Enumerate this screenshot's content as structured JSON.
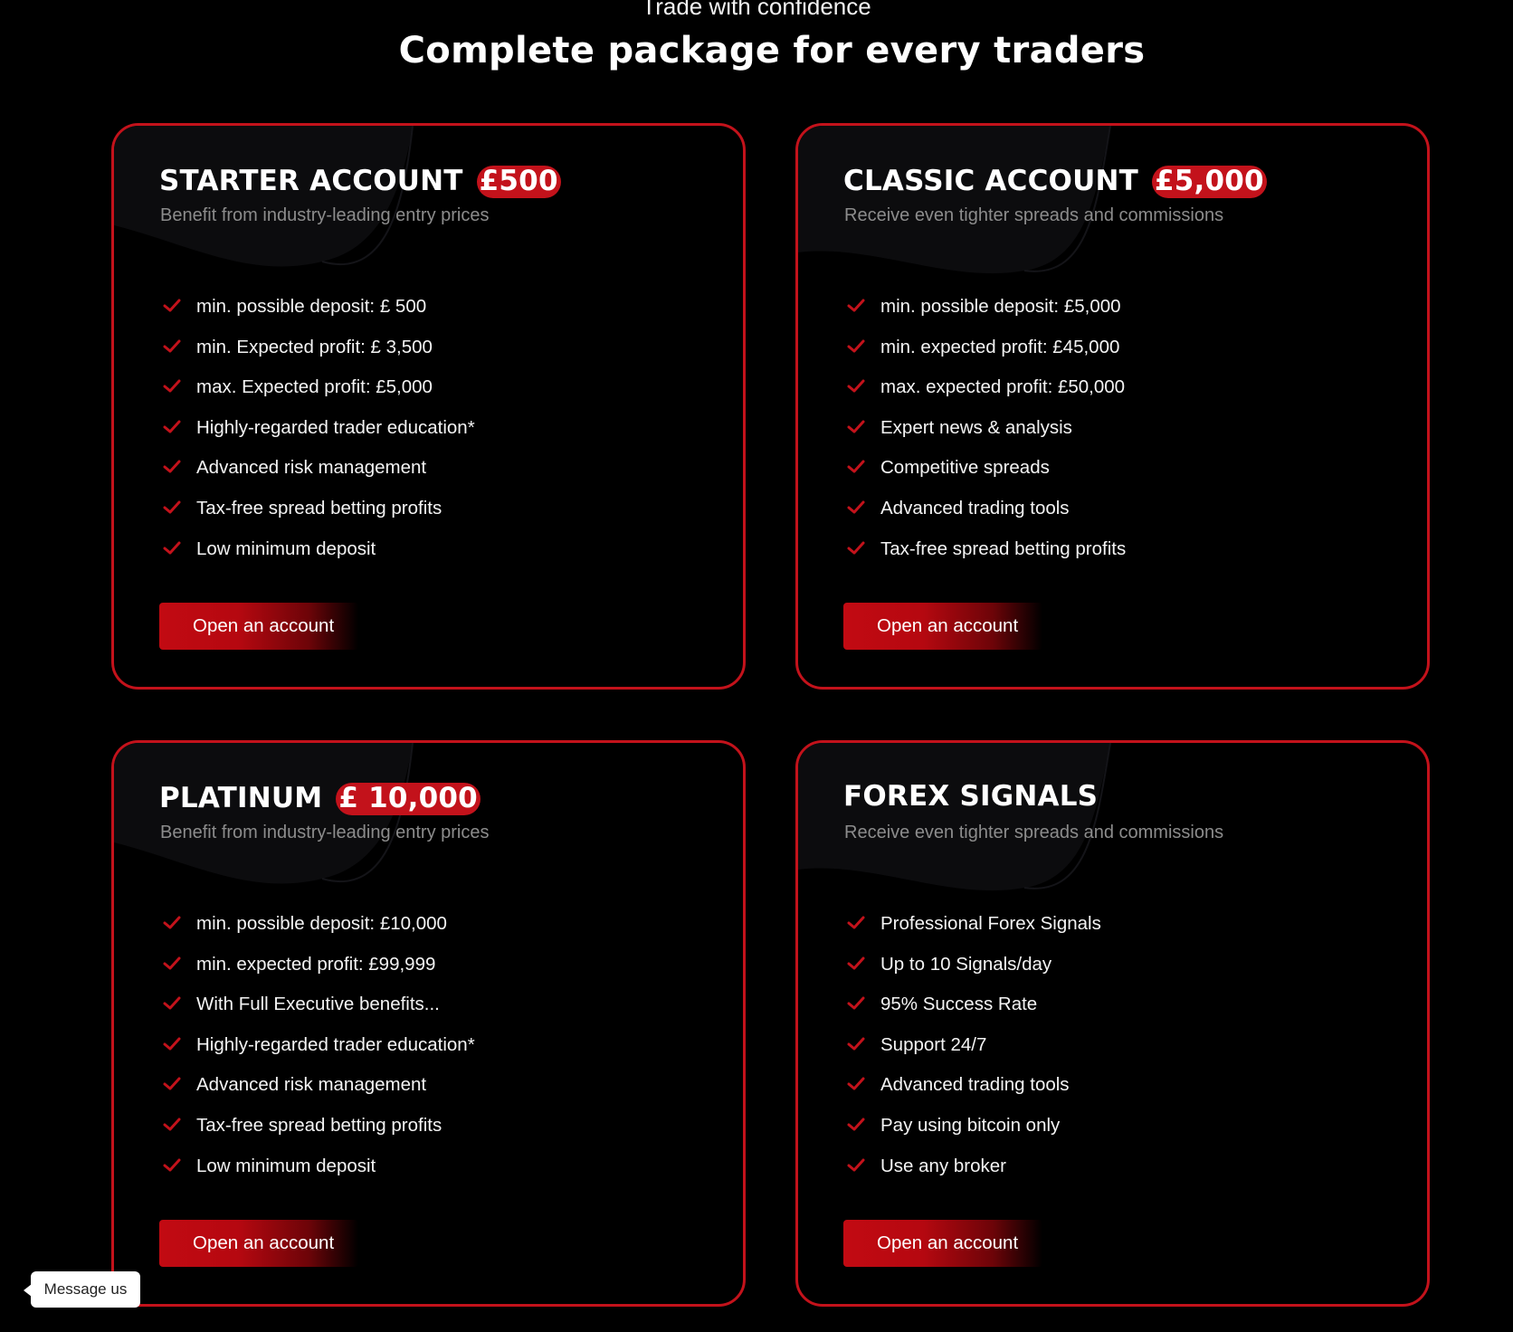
{
  "header": {
    "eyebrow": "Trade with confidence",
    "title": "Complete package for every traders"
  },
  "accent_color": "#c3121b",
  "cards": [
    {
      "title": "STARTER ACCOUNT",
      "price": "£500",
      "subtitle": "Benefit from industry-leading entry prices",
      "features": [
        "min. possible deposit: £ 500",
        "min. Expected profit: £ 3,500",
        "max. Expected profit: £5,000",
        "Highly-regarded trader education*",
        "Advanced risk management",
        "Tax-free spread betting profits",
        "Low minimum deposit"
      ],
      "cta": "Open an account"
    },
    {
      "title": "CLASSIC ACCOUNT",
      "price": "£5,000",
      "subtitle": "Receive even tighter spreads and commissions",
      "features": [
        "min. possible deposit: £5,000",
        "min. expected profit: £45,000",
        "max. expected profit: £50,000",
        "Expert news & analysis",
        "Competitive spreads",
        "Advanced trading tools",
        "Tax-free spread betting profits"
      ],
      "cta": "Open an account"
    },
    {
      "title": "PLATINUM",
      "price": "£ 10,000",
      "subtitle": "Benefit from industry-leading entry prices",
      "features": [
        "min. possible deposit: £10,000",
        "min. expected profit: £99,999",
        "With Full Executive benefits...",
        "Highly-regarded trader education*",
        "Advanced risk management",
        "Tax-free spread betting profits",
        "Low minimum deposit"
      ],
      "cta": "Open an account"
    },
    {
      "title": "FOREX SIGNALS",
      "price": "",
      "subtitle": "Receive even tighter spreads and commissions",
      "features": [
        "Professional Forex Signals",
        "Up to 10 Signals/day",
        "95% Success Rate",
        "Support 24/7",
        "Advanced trading tools",
        "Pay using bitcoin only",
        "Use any broker"
      ],
      "cta": "Open an account"
    }
  ],
  "chat_widget": {
    "label": "Message us"
  }
}
